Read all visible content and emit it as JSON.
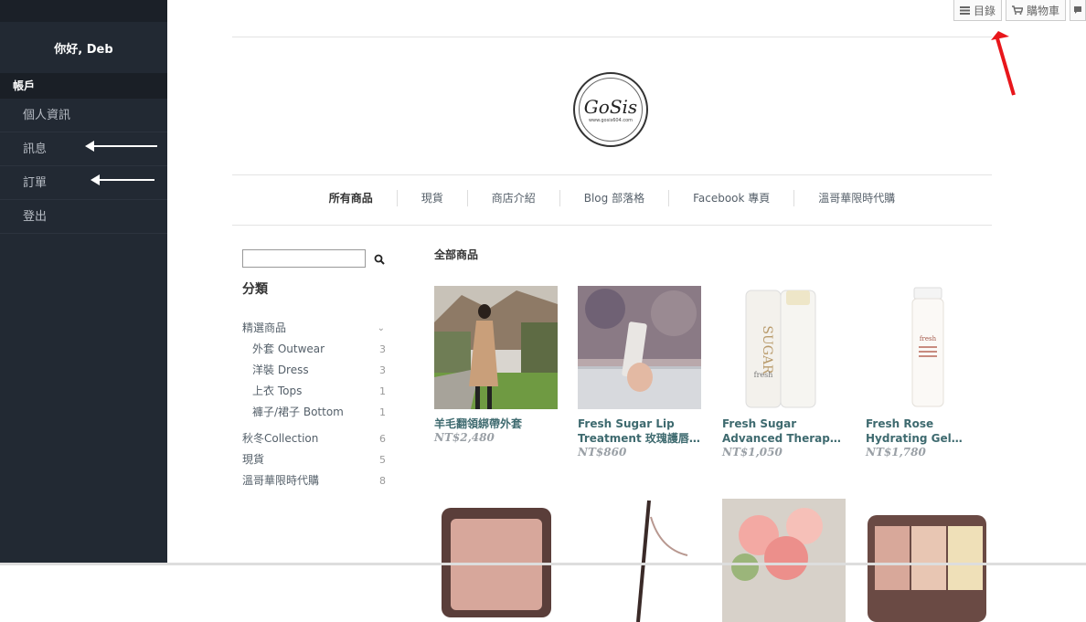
{
  "sidebar": {
    "greeting": "你好, Deb",
    "section": "帳戶",
    "items": [
      {
        "label": "個人資訊"
      },
      {
        "label": "訊息"
      },
      {
        "label": "訂單"
      },
      {
        "label": "登出"
      }
    ]
  },
  "topbar": {
    "menu_label": "目錄",
    "cart_label": "購物車"
  },
  "logo": {
    "text": "GoSis",
    "sub": "www.gosis604.com"
  },
  "nav": {
    "items": [
      "所有商品",
      "現貨",
      "商店介紹",
      "Blog 部落格",
      "Facebook 專頁",
      "溫哥華限時代購"
    ]
  },
  "categories": {
    "title": "分類",
    "groups": [
      {
        "label": "精選商品",
        "count": "",
        "sub": [
          {
            "label": "外套 Outwear",
            "count": "3"
          },
          {
            "label": "洋裝 Dress",
            "count": "3"
          },
          {
            "label": "上衣 Tops",
            "count": "1"
          },
          {
            "label": "褲子/裙子 Bottom",
            "count": "1"
          }
        ]
      },
      {
        "label": "秋冬Collection",
        "count": "6"
      },
      {
        "label": "現貨",
        "count": "5"
      },
      {
        "label": "溫哥華限時代購",
        "count": "8"
      }
    ]
  },
  "main": {
    "title": "全部商品",
    "products": [
      {
        "name": "羊毛翻領綁帶外套",
        "price": "NT$2,480"
      },
      {
        "name": "Fresh Sugar Lip Treatment 玫瑰護唇膏...",
        "price": "NT$860"
      },
      {
        "name": "Fresh Sugar Advanced Therapy Lip Treatme...",
        "price": "NT$1,050"
      },
      {
        "name": "Fresh Rose Hydrating Gel Cream 玫瑰保濕...",
        "price": "NT$1,780"
      }
    ]
  },
  "colors": {
    "sidebar_bg": "#222933",
    "link_teal": "#3e6a6f",
    "annotation_red": "#e8161b"
  }
}
